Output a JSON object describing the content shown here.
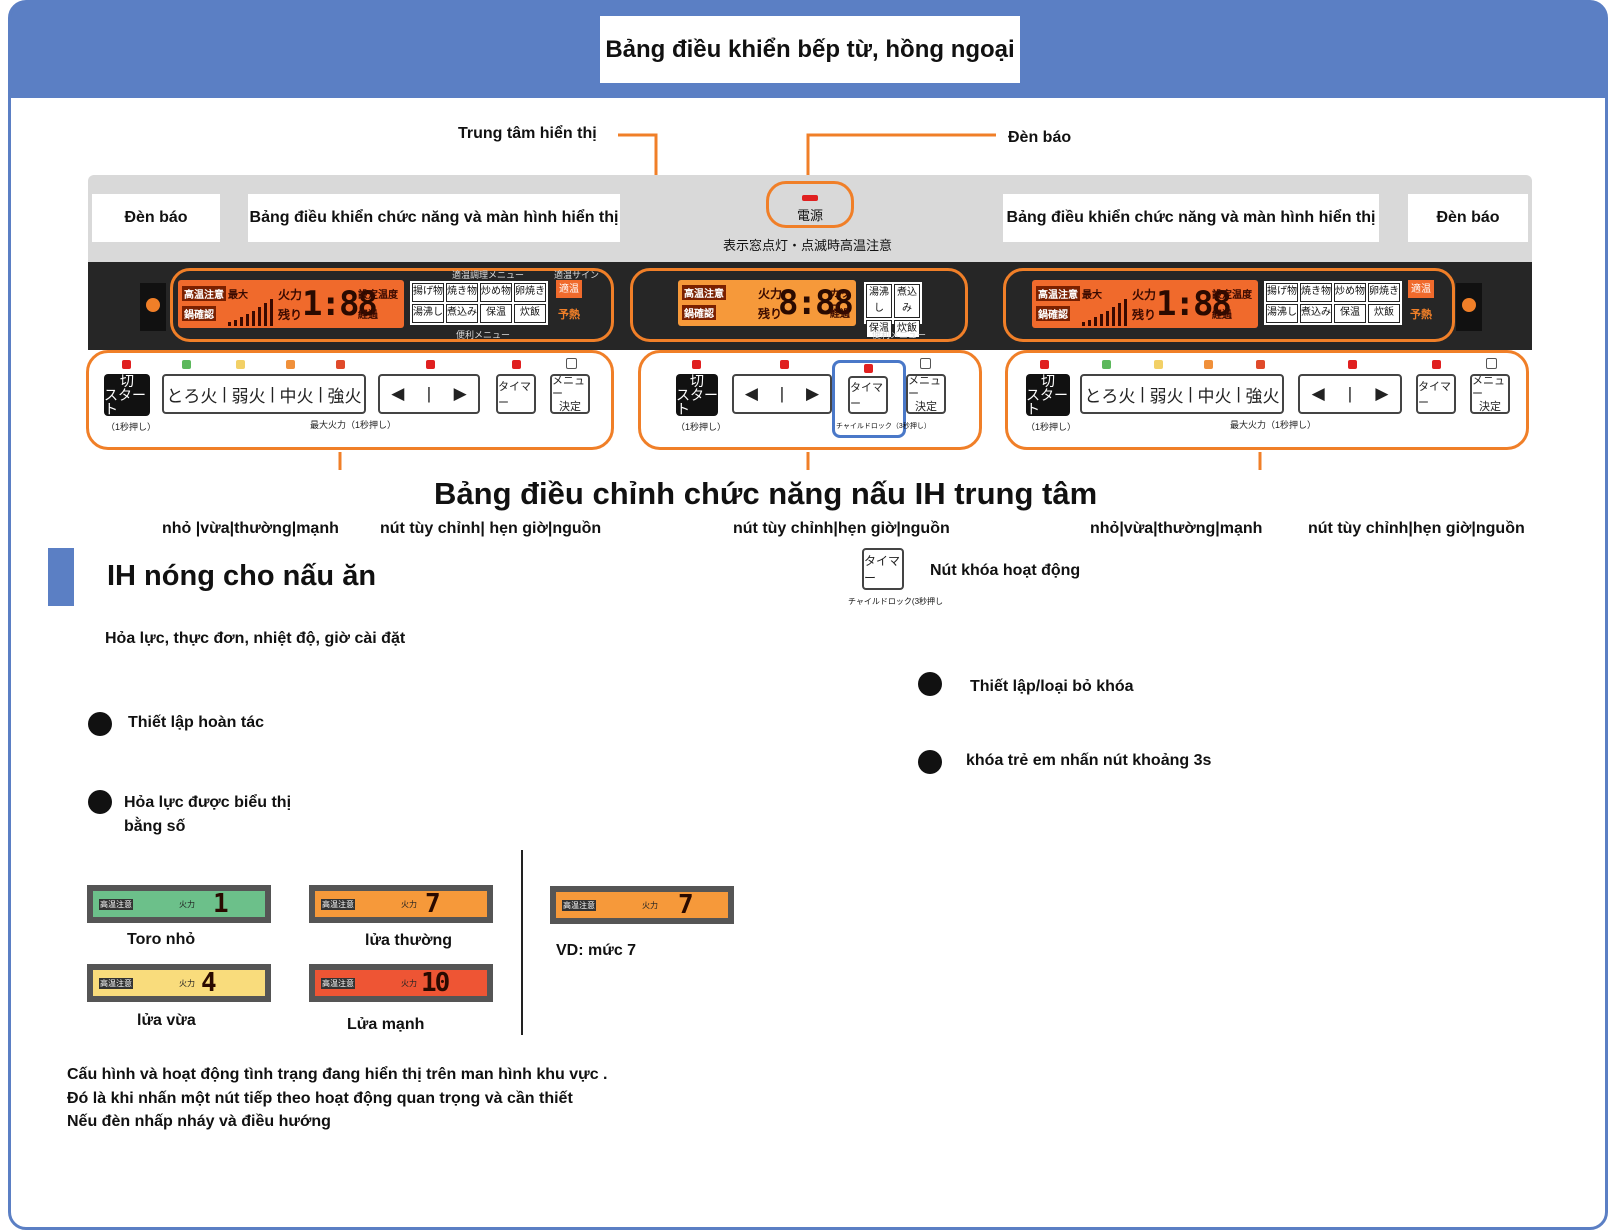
{
  "header": {
    "title": "Bảng điều khiển bếp từ, hồng ngoại"
  },
  "callouts": {
    "display_center": "Trung tâm hiển thị",
    "indicator_top": "Đèn báo",
    "indicator_left": "Đèn báo",
    "indicator_right": "Đèn báo",
    "panel_left": "Bảng điều khiển chức năng và màn hình hiển thị",
    "panel_right": "Bảng điều khiển chức năng và màn hình hiển thị"
  },
  "panel": {
    "power_label": "電源",
    "power_note": "表示窓点灯・点滅時高温注意",
    "menu_top": "適温調理メニュー",
    "menu_bottom": "便利メニュー",
    "sign_label": "適温サイン",
    "lcd_left": {
      "warn1": "高温注意",
      "warn2": "鍋確認",
      "max": "最大",
      "fire": "火力",
      "remain": "残り",
      "digits": "1:88",
      "set_temp": "設定温度",
      "elapsed": "経過",
      "cup": "カップ"
    },
    "lcd_center": {
      "warn1": "高温注意",
      "warn2": "鍋確認",
      "fire": "火力",
      "remain": "残り",
      "digits": "8:88",
      "cup": "カップ",
      "elapsed": "経過"
    },
    "menu_items_side": [
      "揚げ物",
      "焼き物",
      "炒め物",
      "卵焼き",
      "湯沸し",
      "煮込み",
      "保温",
      "炊飯"
    ],
    "menu_items_center": [
      "湯沸し",
      "煮込み",
      "保温",
      "炊飯"
    ],
    "sign_items": [
      "適温",
      "予熱"
    ],
    "btn_start": [
      "切",
      "スタート"
    ],
    "btn_start_note": "（1秒押し）",
    "heat_buttons": [
      "とろ火",
      "弱火",
      "中火",
      "強火"
    ],
    "max_note": "最大火力（1秒押し）",
    "arrow_left": "◀",
    "arrow_right": "▶",
    "timer": "タイマー",
    "menu_btn": [
      "メニュー",
      "決定"
    ],
    "child_lock": "チャイルドロック（3秒押し）"
  },
  "section_heading": "Bảng điều chỉnh chức năng nấu IH trung tâm",
  "sub_labels": {
    "left_heat": "nhỏ |vừa|thường|mạnh",
    "left_custom": "nút tùy chỉnh| hẹn giờ|nguồn",
    "center_custom": "nút tùy chỉnh|hẹn giờ|nguồn",
    "right_heat": "nhỏ|vừa|thường|mạnh",
    "right_custom": "nút tùy chỉnh|hẹn giờ|nguồn"
  },
  "lock": {
    "button_text": "タイマー",
    "button_note": "チャイルドロック(3秒押し",
    "label": "Nút khóa hoạt động"
  },
  "ih": {
    "title": "IH nóng cho nấu ăn",
    "subtitle": "Hỏa lực, thực đơn, nhiệt độ, giờ cài đặt",
    "bullet1": "Thiết lập hoàn tác",
    "bullet2_line1": "Hỏa lực được biểu thị",
    "bullet2_line2": "bằng số"
  },
  "lock_bullets": [
    "Thiết lập/loại bỏ khóa",
    "khóa trẻ em nhấn nút khoảng 3s"
  ],
  "levels": [
    {
      "caption": "Toro nhỏ",
      "digit": "1",
      "color": "#6cc08a"
    },
    {
      "caption": "lửa thường",
      "digit": "7",
      "color": "#f6993a"
    },
    {
      "caption": "lửa vừa",
      "digit": "4",
      "color": "#f9dc7c"
    },
    {
      "caption": "Lửa mạnh",
      "digit": "10",
      "color": "#ee5534"
    }
  ],
  "level_labels": {
    "warn": "高温注意",
    "fire": "火力"
  },
  "example": {
    "caption": "VD: mức 7",
    "digit": "7",
    "color": "#f6993a"
  },
  "footer": [
    "Cấu hình và hoạt động tình trạng đang hiển thị trên man hình khu vực .",
    "Đó là khi nhấn một nút tiếp theo hoạt động quan trọng và cần thiết",
    "Nếu đèn nhấp nháy và điều hướng"
  ],
  "colors": {
    "frame_blue": "#5b7fc4",
    "callout_orange": "#f07f28",
    "lcd_orange": "#f06a2c",
    "lock_blue": "#4a78c8"
  }
}
